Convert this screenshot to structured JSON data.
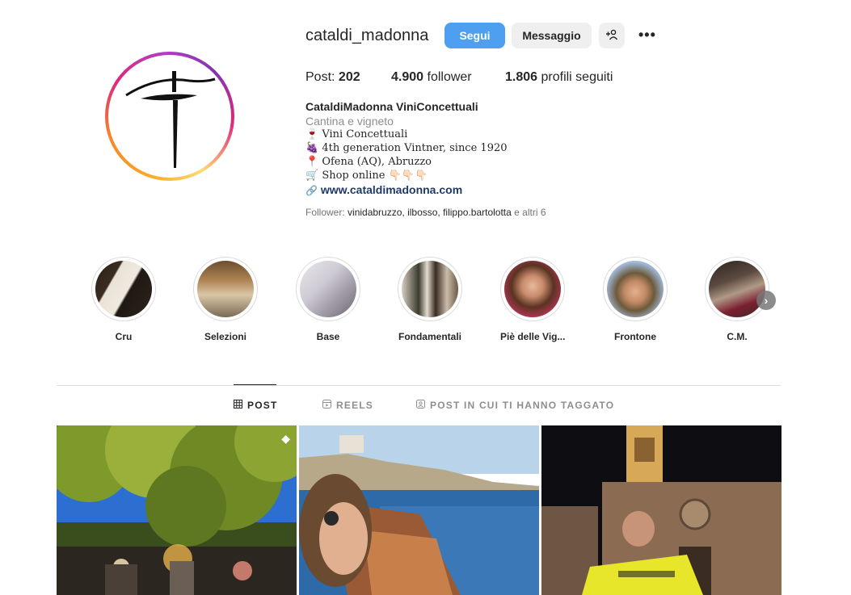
{
  "profile": {
    "username": "cataldi_madonna",
    "follow_label": "Segui",
    "message_label": "Messaggio",
    "add_user_icon": "add-user-icon",
    "more_icon": "more-icon",
    "more_glyph": "•••"
  },
  "stats": {
    "posts_label": "Post:",
    "posts_count": "202",
    "followers_count": "4.900",
    "followers_label": "follower",
    "following_count": "1.806",
    "following_label": "profili seguiti"
  },
  "bio": {
    "name": "CataldiMadonna ViniConcettuali",
    "category": "Cantina e vigneto",
    "line1": "🍷 Vini Concettuali",
    "line2": "🍇 4th generation Vintner, since 1920",
    "line3": "📍 Ofena (AQ), Abruzzo",
    "line4": "🛒 Shop online 👇🏻👇🏻👇🏻",
    "link": "www.cataldimadonna.com",
    "followed_by_prefix": "Follower:",
    "followed_by_names": "vinidabruzzo, ilbosso, filippo.bartolotta",
    "followed_by_suffix": "e altri 6"
  },
  "highlights": [
    {
      "label": "Cru"
    },
    {
      "label": "Selezioni"
    },
    {
      "label": "Base"
    },
    {
      "label": "Fondamentali"
    },
    {
      "label": "Piè delle Vig..."
    },
    {
      "label": "Frontone"
    },
    {
      "label": "C.M."
    }
  ],
  "tabs": {
    "post": "POST",
    "reels": "REELS",
    "tagged": "POST IN CUI TI HANNO TAGGATO"
  },
  "colors": {
    "follow_button": "#4f9ff1",
    "link": "#1e3a66",
    "secondary_text": "#8e8e8e"
  }
}
